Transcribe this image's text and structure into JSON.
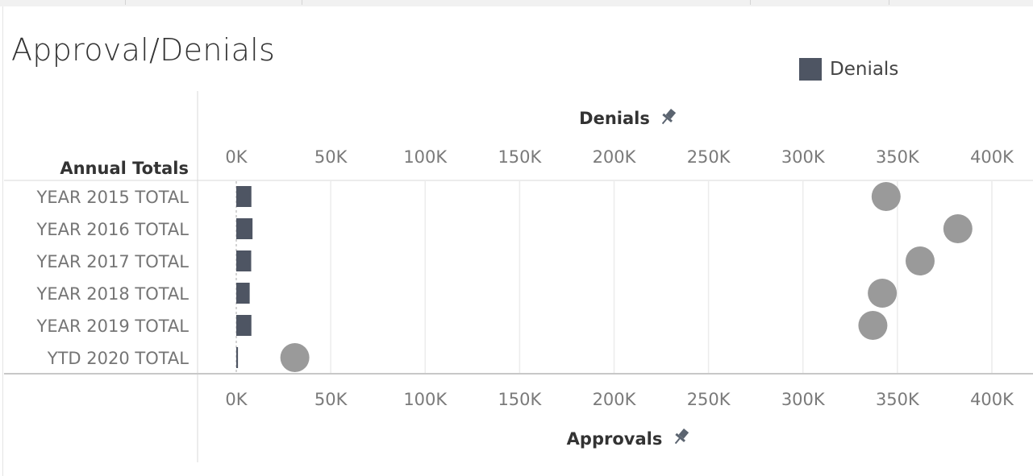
{
  "title": "Approval/Denials",
  "legend": {
    "label": "Denials",
    "color": "#4e5563"
  },
  "chart_data": {
    "type": "bar",
    "row_header": "Annual Totals",
    "categories": [
      "YEAR 2015 TOTAL",
      "YEAR 2016 TOTAL",
      "YEAR 2017 TOTAL",
      "YEAR 2018 TOTAL",
      "YEAR 2019 TOTAL",
      "YTD 2020 TOTAL"
    ],
    "top_axis_label": "Denials",
    "bottom_axis_label": "Approvals",
    "xlim": [
      0,
      400000
    ],
    "ticks": [
      0,
      50000,
      100000,
      150000,
      200000,
      250000,
      300000,
      350000,
      400000
    ],
    "tick_labels": [
      "0K",
      "50K",
      "100K",
      "150K",
      "200K",
      "250K",
      "300K",
      "350K",
      "400K"
    ],
    "series": [
      {
        "name": "Denials",
        "mark": "bar",
        "color": "#4e5563",
        "values": [
          8000,
          8600,
          7900,
          7100,
          8000,
          900
        ]
      },
      {
        "name": "Approvals",
        "mark": "circle",
        "color": "#9a9a9a",
        "values": [
          344000,
          382000,
          362000,
          342000,
          337000,
          31000
        ]
      }
    ],
    "grid": true
  }
}
